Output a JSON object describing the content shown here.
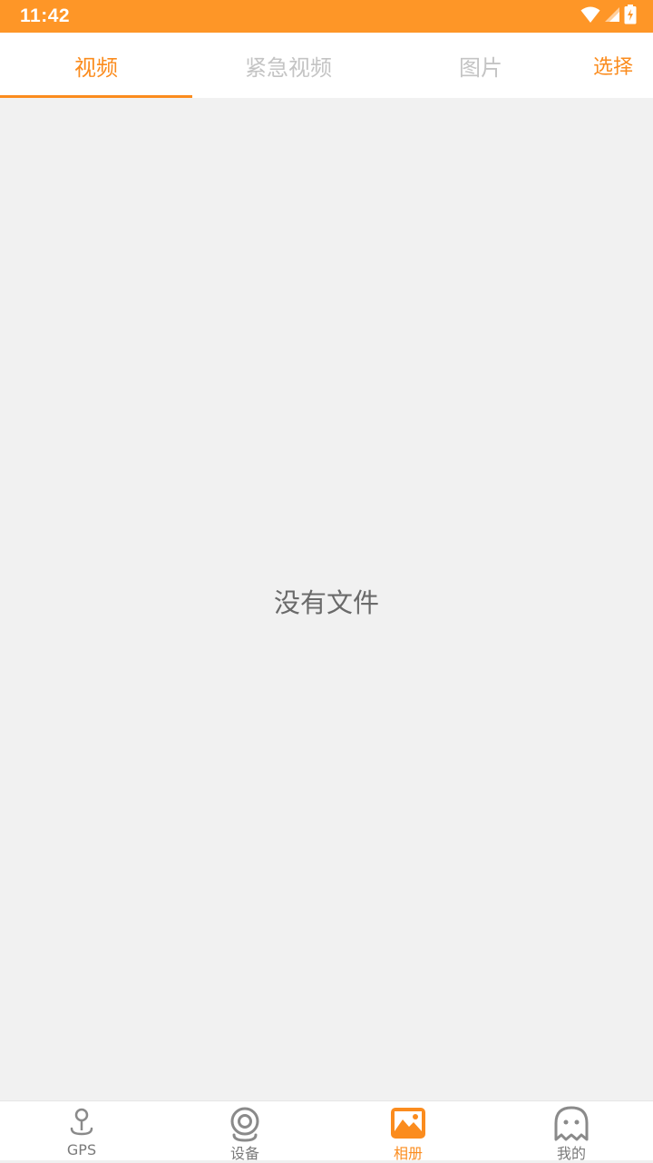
{
  "status_bar": {
    "time": "11:42",
    "icons": [
      "wifi-icon",
      "cell-signal-icon",
      "battery-charging-icon"
    ],
    "color": "#fe9627"
  },
  "tabs": [
    {
      "label": "视频",
      "active": true
    },
    {
      "label": "紧急视频",
      "active": false
    },
    {
      "label": "图片",
      "active": false
    }
  ],
  "toolbar": {
    "select_label": "选择"
  },
  "content": {
    "empty_message": "没有文件"
  },
  "bottom_nav": {
    "items": [
      {
        "label": "GPS",
        "icon": "map-pin-icon",
        "active": false
      },
      {
        "label": "设备",
        "icon": "camera-device-icon",
        "active": false
      },
      {
        "label": "相册",
        "icon": "photo-album-icon",
        "active": true
      },
      {
        "label": "我的",
        "icon": "ghost-profile-icon",
        "active": false
      }
    ]
  },
  "colors": {
    "accent": "#fb8c1e",
    "inactive_tab": "#c4c4c4",
    "background": "#f1f1f1"
  }
}
